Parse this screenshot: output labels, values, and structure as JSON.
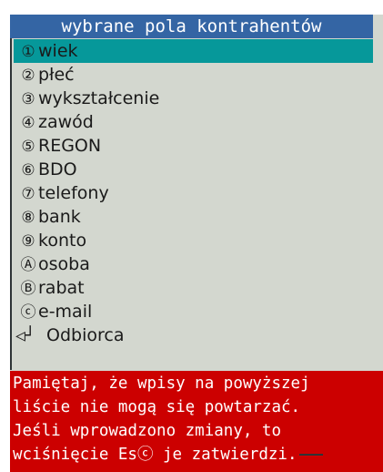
{
  "dialog": {
    "title": "wybrane pola kontrahentów",
    "items": [
      {
        "num": "①",
        "label": "wiek"
      },
      {
        "num": "②",
        "label": "płeć"
      },
      {
        "num": "③",
        "label": "wykształcenie"
      },
      {
        "num": "④",
        "label": "zawód"
      },
      {
        "num": "⑤",
        "label": "REGON"
      },
      {
        "num": "⑥",
        "label": "BDO"
      },
      {
        "num": "⑦",
        "label": "telefony"
      },
      {
        "num": "⑧",
        "label": "bank"
      },
      {
        "num": "⑨",
        "label": "konto"
      },
      {
        "num": "Ⓐ",
        "label": "osoba"
      },
      {
        "num": "Ⓑ",
        "label": "rabat"
      },
      {
        "num": "ⓒ",
        "label": "e-mail"
      }
    ],
    "back": {
      "icon": "return-arrow-icon",
      "glyph": "◁┘",
      "label": "Odbiorca"
    }
  },
  "notice": {
    "lines": [
      "Pamiętaj, że wpisy na powyższej",
      "liście nie mogą się powtarzać.",
      "Jeśli wprowadzono zmiany, to",
      "wciśnięcie Esⓒ je zatwierdzi."
    ]
  },
  "colors": {
    "title_bg": "#3465a4",
    "selected_bg": "#06989a",
    "panel_bg": "#d3d7cf",
    "notice_bg": "#cc0000"
  }
}
